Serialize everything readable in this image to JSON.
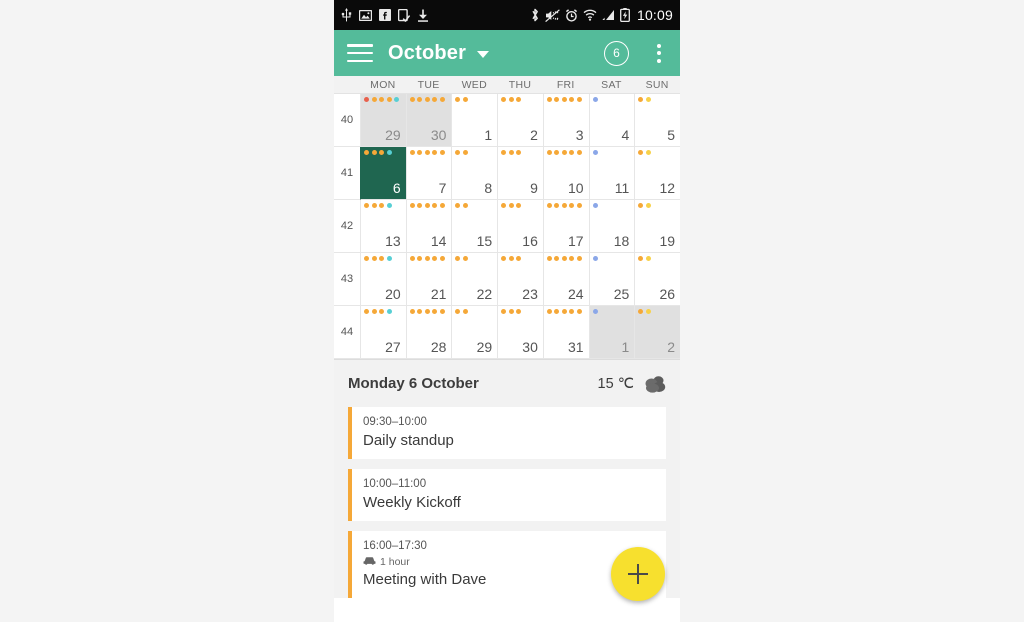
{
  "statusbar": {
    "icons_left": [
      "usb-icon",
      "screenshot-image-icon",
      "facebook-icon",
      "app-update-icon",
      "download-icon"
    ],
    "icons_right": [
      "bluetooth-icon",
      "mute-vibrate-icon",
      "alarm-clock-icon",
      "wifi-icon",
      "cellular-signal-icon",
      "battery-charging-icon"
    ],
    "time": "10:09"
  },
  "toolbar": {
    "menu_icon": "hamburger-menu-icon",
    "title": "October",
    "caret_icon": "chevron-down-icon",
    "today_badge": "6",
    "overflow_icon": "overflow-menu-icon"
  },
  "calendar": {
    "weekday_labels": [
      "MON",
      "TUE",
      "WED",
      "THU",
      "FRI",
      "SAT",
      "SUN"
    ],
    "dot_colors": {
      "red": "#e8604c",
      "orange": "#f5a838",
      "cyan": "#57cfd4",
      "blue": "#8ba7e8",
      "yellow": "#f7d14a"
    },
    "selected_bg": "#1f6650",
    "weeks": [
      {
        "number": "40",
        "days": [
          {
            "label": "29",
            "other_month": true,
            "selected": false,
            "dots": [
              "red",
              "orange",
              "orange",
              "orange",
              "cyan"
            ]
          },
          {
            "label": "30",
            "other_month": true,
            "selected": false,
            "dots": [
              "orange",
              "orange",
              "orange",
              "orange",
              "orange"
            ]
          },
          {
            "label": "1",
            "other_month": false,
            "selected": false,
            "dots": [
              "orange",
              "orange"
            ]
          },
          {
            "label": "2",
            "other_month": false,
            "selected": false,
            "dots": [
              "orange",
              "orange",
              "orange"
            ]
          },
          {
            "label": "3",
            "other_month": false,
            "selected": false,
            "dots": [
              "orange",
              "orange",
              "orange",
              "orange",
              "orange"
            ]
          },
          {
            "label": "4",
            "other_month": false,
            "selected": false,
            "dots": [
              "blue"
            ]
          },
          {
            "label": "5",
            "other_month": false,
            "selected": false,
            "dots": [
              "orange",
              "yellow"
            ]
          }
        ]
      },
      {
        "number": "41",
        "days": [
          {
            "label": "6",
            "other_month": false,
            "selected": true,
            "dots": [
              "orange",
              "orange",
              "orange",
              "cyan"
            ]
          },
          {
            "label": "7",
            "other_month": false,
            "selected": false,
            "dots": [
              "orange",
              "orange",
              "orange",
              "orange",
              "orange"
            ]
          },
          {
            "label": "8",
            "other_month": false,
            "selected": false,
            "dots": [
              "orange",
              "orange"
            ]
          },
          {
            "label": "9",
            "other_month": false,
            "selected": false,
            "dots": [
              "orange",
              "orange",
              "orange"
            ]
          },
          {
            "label": "10",
            "other_month": false,
            "selected": false,
            "dots": [
              "orange",
              "orange",
              "orange",
              "orange",
              "orange"
            ]
          },
          {
            "label": "11",
            "other_month": false,
            "selected": false,
            "dots": [
              "blue"
            ]
          },
          {
            "label": "12",
            "other_month": false,
            "selected": false,
            "dots": [
              "orange",
              "yellow"
            ]
          }
        ]
      },
      {
        "number": "42",
        "days": [
          {
            "label": "13",
            "other_month": false,
            "selected": false,
            "dots": [
              "orange",
              "orange",
              "orange",
              "cyan"
            ]
          },
          {
            "label": "14",
            "other_month": false,
            "selected": false,
            "dots": [
              "orange",
              "orange",
              "orange",
              "orange",
              "orange"
            ]
          },
          {
            "label": "15",
            "other_month": false,
            "selected": false,
            "dots": [
              "orange",
              "orange"
            ]
          },
          {
            "label": "16",
            "other_month": false,
            "selected": false,
            "dots": [
              "orange",
              "orange",
              "orange"
            ]
          },
          {
            "label": "17",
            "other_month": false,
            "selected": false,
            "dots": [
              "orange",
              "orange",
              "orange",
              "orange",
              "orange"
            ]
          },
          {
            "label": "18",
            "other_month": false,
            "selected": false,
            "dots": [
              "blue"
            ]
          },
          {
            "label": "19",
            "other_month": false,
            "selected": false,
            "dots": [
              "orange",
              "yellow"
            ]
          }
        ]
      },
      {
        "number": "43",
        "days": [
          {
            "label": "20",
            "other_month": false,
            "selected": false,
            "dots": [
              "orange",
              "orange",
              "orange",
              "cyan"
            ]
          },
          {
            "label": "21",
            "other_month": false,
            "selected": false,
            "dots": [
              "orange",
              "orange",
              "orange",
              "orange",
              "orange"
            ]
          },
          {
            "label": "22",
            "other_month": false,
            "selected": false,
            "dots": [
              "orange",
              "orange"
            ]
          },
          {
            "label": "23",
            "other_month": false,
            "selected": false,
            "dots": [
              "orange",
              "orange",
              "orange"
            ]
          },
          {
            "label": "24",
            "other_month": false,
            "selected": false,
            "dots": [
              "orange",
              "orange",
              "orange",
              "orange",
              "orange"
            ]
          },
          {
            "label": "25",
            "other_month": false,
            "selected": false,
            "dots": [
              "blue"
            ]
          },
          {
            "label": "26",
            "other_month": false,
            "selected": false,
            "dots": [
              "orange",
              "yellow"
            ]
          }
        ]
      },
      {
        "number": "44",
        "days": [
          {
            "label": "27",
            "other_month": false,
            "selected": false,
            "dots": [
              "orange",
              "orange",
              "orange",
              "cyan"
            ]
          },
          {
            "label": "28",
            "other_month": false,
            "selected": false,
            "dots": [
              "orange",
              "orange",
              "orange",
              "orange",
              "orange"
            ]
          },
          {
            "label": "29",
            "other_month": false,
            "selected": false,
            "dots": [
              "orange",
              "orange"
            ]
          },
          {
            "label": "30",
            "other_month": false,
            "selected": false,
            "dots": [
              "orange",
              "orange",
              "orange"
            ]
          },
          {
            "label": "31",
            "other_month": false,
            "selected": false,
            "dots": [
              "orange",
              "orange",
              "orange",
              "orange",
              "orange"
            ]
          },
          {
            "label": "1",
            "other_month": true,
            "selected": false,
            "dots": [
              "blue"
            ]
          },
          {
            "label": "2",
            "other_month": true,
            "selected": false,
            "dots": [
              "orange",
              "yellow"
            ]
          }
        ]
      }
    ]
  },
  "dayheader": {
    "date": "Monday 6 October",
    "temperature": "15 ℃",
    "weather_icon": "cloudy-icon"
  },
  "events": [
    {
      "time": "09:30–10:00",
      "title": "Daily standup",
      "travel": null,
      "travel_icon": null
    },
    {
      "time": "10:00–11:00",
      "title": "Weekly Kickoff",
      "travel": null,
      "travel_icon": null
    },
    {
      "time": "16:00–17:30",
      "title": "Meeting with Dave",
      "travel": "1 hour",
      "travel_icon": "car-icon"
    }
  ],
  "fab": {
    "icon": "plus-icon",
    "color": "#f7e02e"
  }
}
